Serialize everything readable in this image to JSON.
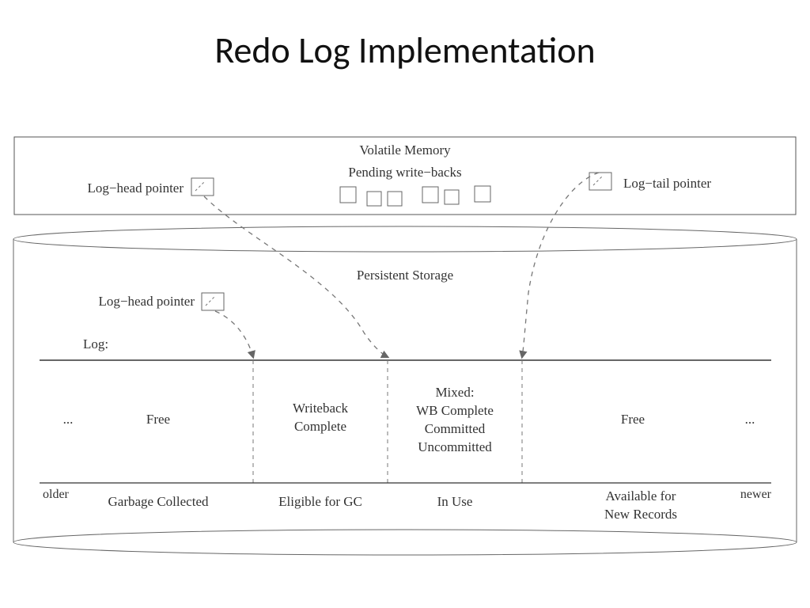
{
  "title": "Redo Log Implementation",
  "volatile": {
    "heading": "Volatile Memory",
    "pending": "Pending write−backs",
    "log_head": "Log−head pointer",
    "log_tail": "Log−tail pointer"
  },
  "persistent": {
    "heading": "Persistent Storage",
    "log_head": "Log−head pointer",
    "log_label": "Log:"
  },
  "regions": {
    "free_left": "Free",
    "writeback": "Writeback\nComplete",
    "mixed": "Mixed:\nWB Complete\nCommitted\nUncommitted",
    "free_right": "Free",
    "ellipsis_left": "...",
    "ellipsis_right": "..."
  },
  "states": {
    "garbage": "Garbage Collected",
    "eligible": "Eligible for GC",
    "inuse": "In Use",
    "available": "Available for\nNew Records"
  },
  "arrows": {
    "older": "older",
    "newer": "newer"
  }
}
